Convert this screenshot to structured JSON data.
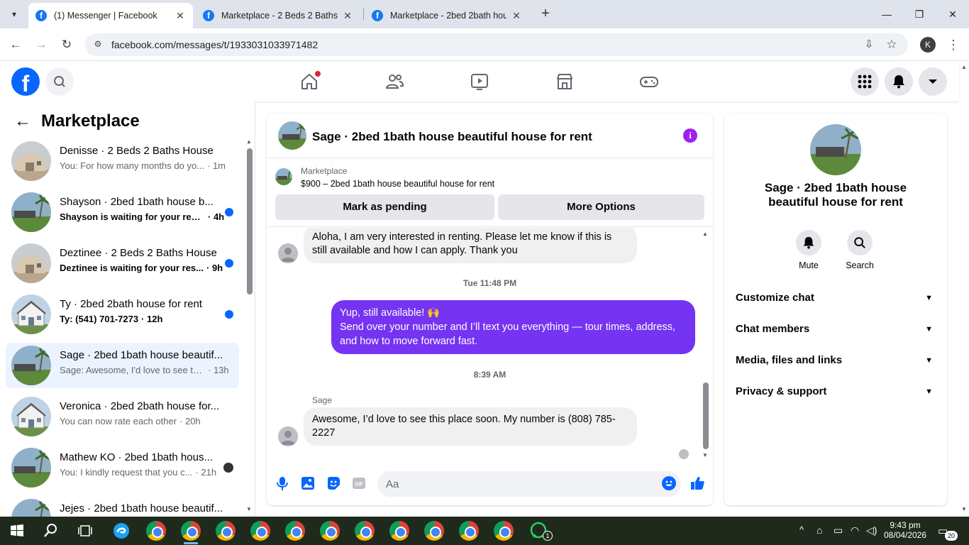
{
  "browser": {
    "tabs": [
      {
        "title": "(1) Messenger | Facebook",
        "active": true
      },
      {
        "title": "Marketplace - 2 Beds 2 Baths H",
        "active": false
      },
      {
        "title": "Marketplace - 2bed 2bath hous",
        "active": false
      }
    ],
    "url": "facebook.com/messages/t/1933031033971482",
    "profile_initial": "K"
  },
  "colors": {
    "fb_blue": "#0866ff",
    "outgoing_bubble": "#7533f2",
    "unread_dot": "#0866ff",
    "selected_row": "#ebf3ff",
    "notification_red": "#e41e3f"
  },
  "left_panel": {
    "title": "Marketplace",
    "chats": [
      {
        "name": "Denisse · 2 Beds 2 Baths House",
        "preview": "You: For how many months do yo...",
        "time": "· 1m",
        "unread": false,
        "selected": false,
        "thumb": "tan-house"
      },
      {
        "name": "Shayson · 2bed 1bath house b...",
        "preview": "Shayson is waiting for your resp...",
        "time": "· 4h",
        "unread": true,
        "selected": false,
        "thumb": "palm-house"
      },
      {
        "name": "Deztinee · 2 Beds 2 Baths House",
        "preview": "Deztinee is waiting for your res...",
        "time": "· 9h",
        "unread": true,
        "selected": false,
        "thumb": "tan-house"
      },
      {
        "name": "Ty · 2bed 2bath house for rent",
        "preview": "Ty: (541) 701-7273",
        "time": "· 12h",
        "unread": true,
        "selected": false,
        "thumb": "white-house"
      },
      {
        "name": "Sage · 2bed 1bath house beautif...",
        "preview": "Sage: Awesome, I'd love to see thi...",
        "time": "· 13h",
        "unread": false,
        "selected": true,
        "thumb": "palm-house"
      },
      {
        "name": "Veronica · 2bed 2bath house for...",
        "preview": "You can now rate each other",
        "time": "· 20h",
        "unread": false,
        "selected": false,
        "thumb": "white-house"
      },
      {
        "name": "Mathew KO · 2bed 1bath hous...",
        "preview": "You: I kindly request that you c...",
        "time": "· 21h",
        "unread": false,
        "selected": false,
        "thumb": "palm-house"
      },
      {
        "name": "Jejes · 2bed 1bath house beautif...",
        "preview": "",
        "time": "",
        "unread": false,
        "selected": false,
        "thumb": "palm-house"
      }
    ]
  },
  "conversation": {
    "title": "Sage · 2bed 1bath house beautiful house for rent",
    "listing_source": "Marketplace",
    "listing_desc": "$900 – 2bed 1bath house beautiful house for rent",
    "btn_pending": "Mark as pending",
    "btn_more": "More Options",
    "messages": {
      "incoming_1": "Aloha, I am very interested in renting. Please let me know if this is still available and how I can apply. Thank you",
      "timestamp_1": "Tue 11:48 PM",
      "outgoing_line1": "Yup, still available! 🙌",
      "outgoing_line2": "Send over your number and I’ll text you everything — tour times, address, and how to move forward fast.",
      "timestamp_2": "8:39 AM",
      "sender": "Sage",
      "incoming_2": "Awesome, I’d love to see this place soon. My number is (808) 785-2227"
    },
    "composer_placeholder": "Aa"
  },
  "right_panel": {
    "name": "Sage · 2bed 1bath house beautiful house for rent",
    "actions": [
      {
        "label": "Mute"
      },
      {
        "label": "Search"
      }
    ],
    "sections": [
      {
        "label": "Customize chat"
      },
      {
        "label": "Chat members"
      },
      {
        "label": "Media, files and links"
      },
      {
        "label": "Privacy & support"
      }
    ]
  },
  "taskbar": {
    "time": "9:43 pm",
    "date": "08/04/2026",
    "notifications": "20",
    "whatsapp_badge": "1"
  }
}
